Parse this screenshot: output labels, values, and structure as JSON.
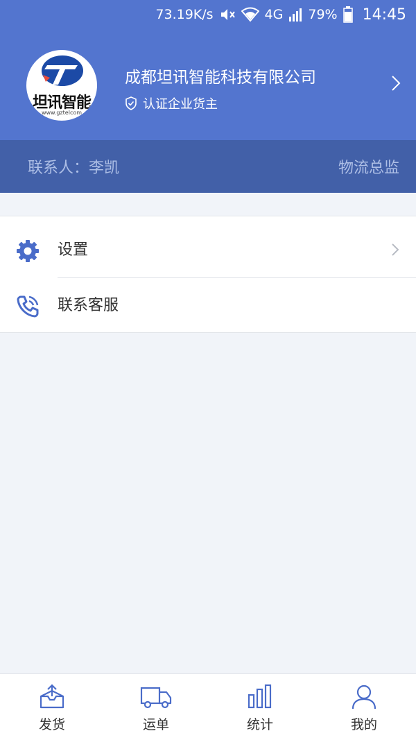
{
  "status_bar": {
    "net_speed": "73.19K/s",
    "network": "4G",
    "battery": "79%",
    "time": "14:45",
    "icons": [
      "mute-icon",
      "wifi-icon",
      "signal-icon",
      "battery-icon"
    ]
  },
  "profile": {
    "logo_text": "坦讯智能",
    "logo_url": "www.gztelcom",
    "company_name": "成都坦讯智能科技有限公司",
    "verify_label": "认证企业货主"
  },
  "contact": {
    "person": "联系人：李凯",
    "role": "物流总监"
  },
  "menu": {
    "items": [
      {
        "label": "设置",
        "icon": "gear-icon"
      },
      {
        "label": "联系客服",
        "icon": "phone-icon"
      }
    ]
  },
  "tabbar": {
    "tabs": [
      {
        "label": "发货",
        "icon": "shipment-box-icon"
      },
      {
        "label": "运单",
        "icon": "truck-icon"
      },
      {
        "label": "统计",
        "icon": "bar-chart-icon"
      },
      {
        "label": "我的",
        "icon": "user-icon"
      }
    ]
  },
  "colors": {
    "primary": "#5375cf",
    "contact_bar": "#4260a8",
    "icon_blue": "#4a6cc9",
    "background": "#f1f4f9"
  }
}
